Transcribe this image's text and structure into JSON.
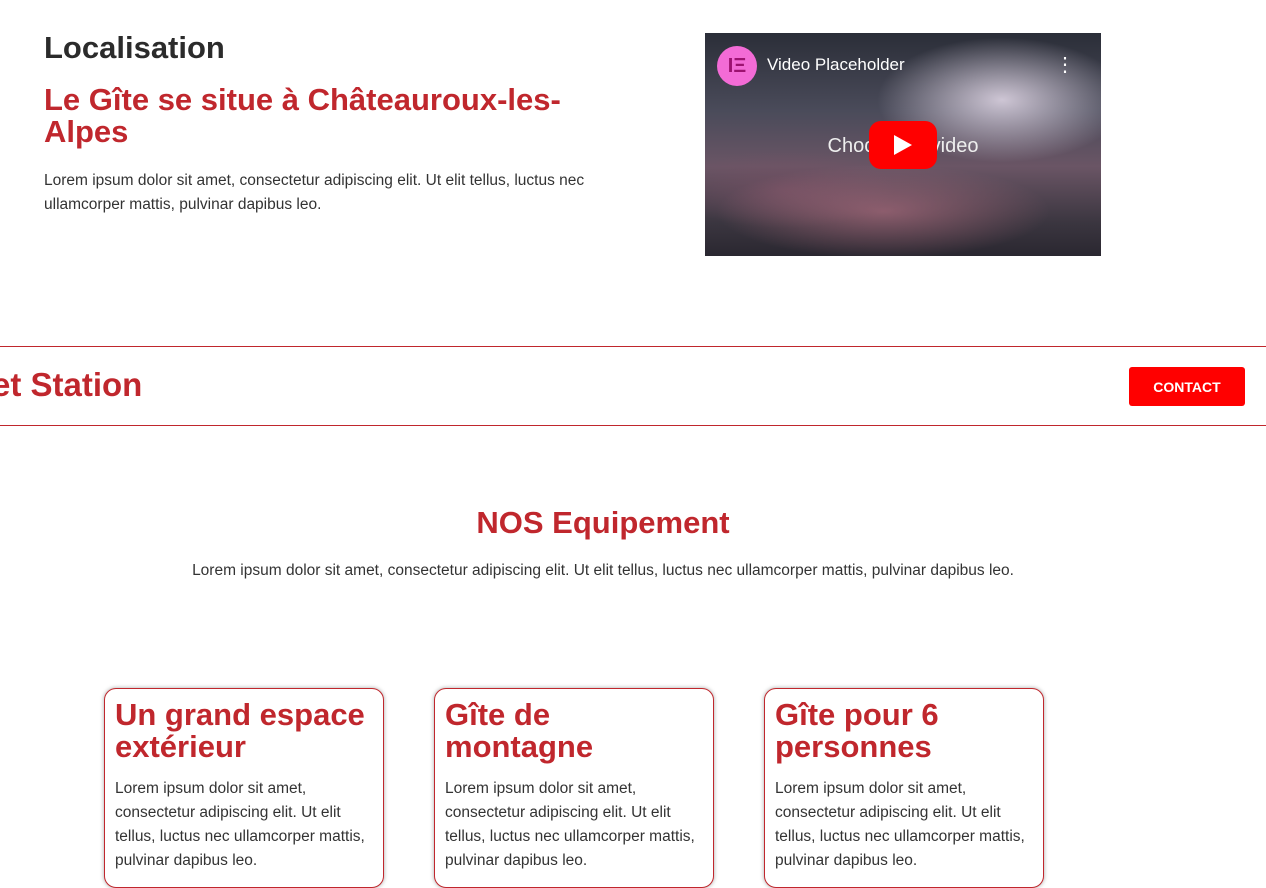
{
  "localisation": {
    "heading": "Localisation",
    "subtitle": "Le Gîte se situe à Châteauroux-les-Alpes",
    "text": "Lorem ipsum dolor sit amet, consectetur adipiscing elit. Ut elit tellus, luctus nec ullamcorper mattis, pulvinar dapibus leo."
  },
  "video": {
    "logo_glyph": "IΞ",
    "title": "Video Placeholder",
    "menu_icon": "⋮",
    "caption": "Choose a video"
  },
  "banner": {
    "text": "et Station",
    "contact_label": "CONTACT"
  },
  "equipment": {
    "title": "NOS Equipement",
    "text": "Lorem ipsum dolor sit amet, consectetur adipiscing elit. Ut elit tellus, luctus nec ullamcorper mattis, pulvinar dapibus leo.",
    "cards": [
      {
        "title": "Un grand espace extérieur",
        "text": "Lorem ipsum dolor sit amet, consectetur adipiscing elit. Ut elit tellus, luctus nec ullamcorper mattis, pulvinar dapibus leo."
      },
      {
        "title": "Gîte de montagne",
        "text": "Lorem ipsum dolor sit amet, consectetur adipiscing elit. Ut elit tellus, luctus nec ullamcorper mattis, pulvinar dapibus leo."
      },
      {
        "title": "Gîte pour 6 personnes",
        "text": "Lorem ipsum dolor sit amet, consectetur adipiscing elit. Ut elit tellus, luctus nec ullamcorper mattis, pulvinar dapibus leo."
      }
    ]
  },
  "colors": {
    "brand_red": "#c0272d",
    "button_red": "#ff0000"
  }
}
